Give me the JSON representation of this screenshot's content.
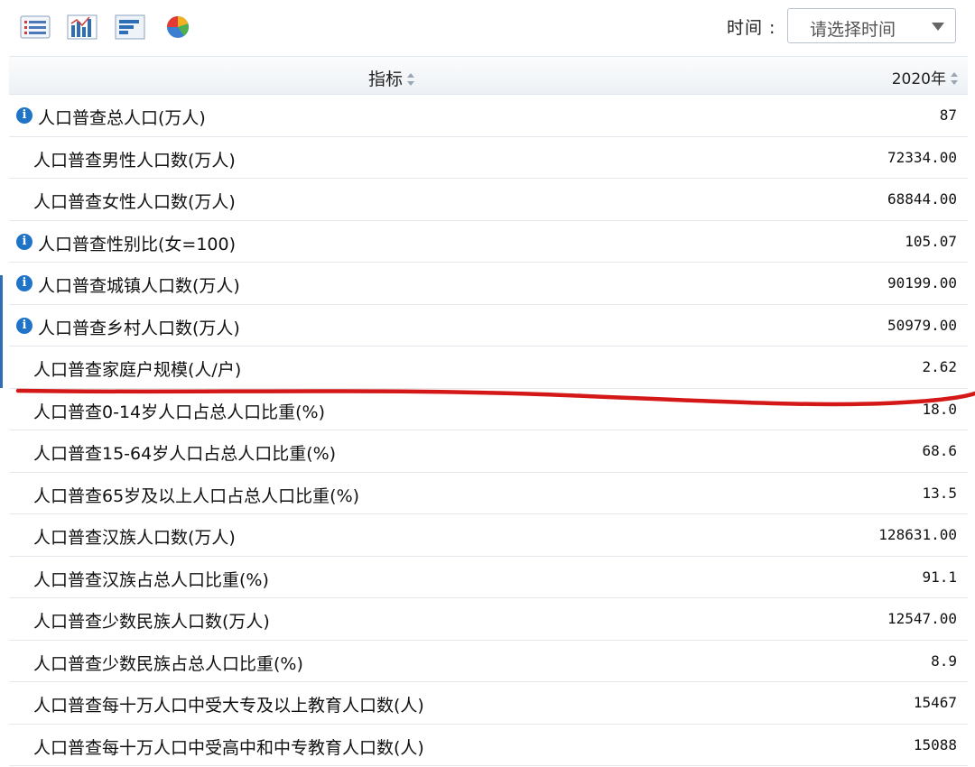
{
  "toolbar": {
    "icons": [
      {
        "name": "table-view-icon"
      },
      {
        "name": "bar-chart-icon"
      },
      {
        "name": "horizontal-bar-chart-icon"
      },
      {
        "name": "pie-chart-icon"
      }
    ],
    "time_label": "时间 :",
    "time_placeholder": "请选择时间"
  },
  "table": {
    "header": {
      "indicator": "指标",
      "year": "2020年"
    },
    "rows": [
      {
        "name": "人口普查总人口(万人)",
        "value": "87",
        "info": true
      },
      {
        "name": "人口普查男性人口数(万人)",
        "value": "72334.00",
        "info": false
      },
      {
        "name": "人口普查女性人口数(万人)",
        "value": "68844.00",
        "info": false
      },
      {
        "name": "人口普查性别比(女=100)",
        "value": "105.07",
        "info": true
      },
      {
        "name": "人口普查城镇人口数(万人)",
        "value": "90199.00",
        "info": true
      },
      {
        "name": "人口普查乡村人口数(万人)",
        "value": "50979.00",
        "info": true
      },
      {
        "name": "人口普查家庭户规模(人/户)",
        "value": "2.62",
        "info": false
      },
      {
        "name": "人口普查0-14岁人口占总人口比重(%)",
        "value": "18.0",
        "info": false
      },
      {
        "name": "人口普查15-64岁人口占总人口比重(%)",
        "value": "68.6",
        "info": false
      },
      {
        "name": "人口普查65岁及以上人口占总人口比重(%)",
        "value": "13.5",
        "info": false
      },
      {
        "name": "人口普查汉族人口数(万人)",
        "value": "128631.00",
        "info": false
      },
      {
        "name": "人口普查汉族占总人口比重(%)",
        "value": "91.1",
        "info": false
      },
      {
        "name": "人口普查少数民族人口数(万人)",
        "value": "12547.00",
        "info": false
      },
      {
        "name": "人口普查少数民族占总人口比重(%)",
        "value": "8.9",
        "info": false
      },
      {
        "name": "人口普查每十万人口中受大专及以上教育人口数(人)",
        "value": "15467",
        "info": false
      },
      {
        "name": "人口普查每十万人口中受高中和中专教育人口数(人)",
        "value": "15088",
        "info": false
      }
    ]
  },
  "colors": {
    "info_icon": "#1f74c7",
    "annotation": "#d41818",
    "border": "#e4e8ed"
  }
}
